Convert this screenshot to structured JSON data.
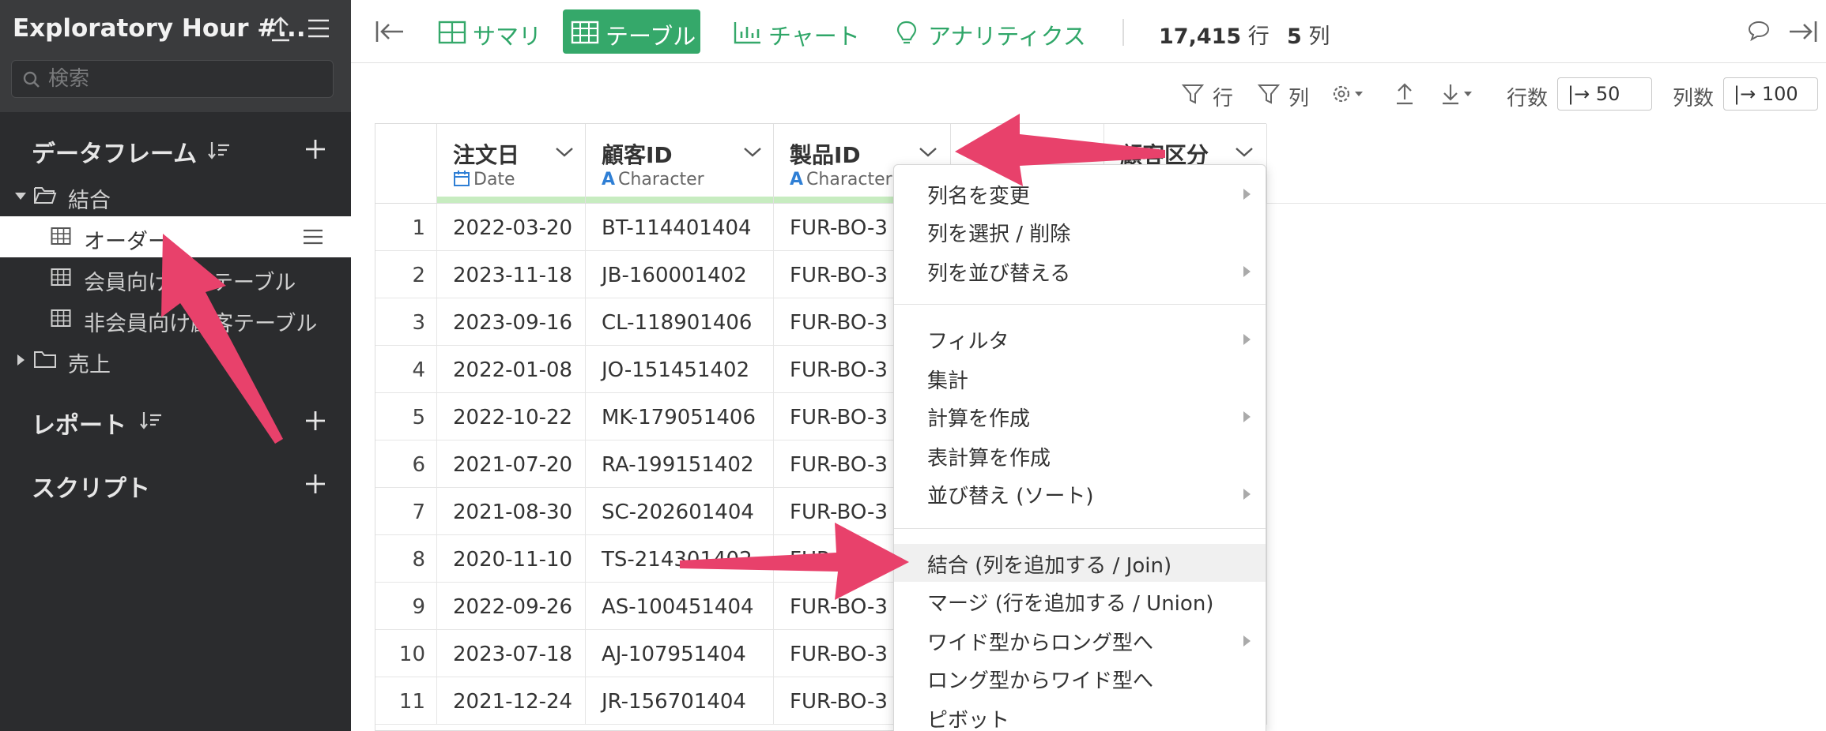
{
  "sidebar": {
    "project_title": "Exploratory Hour #...",
    "search_placeholder": "検索",
    "sections": {
      "dataframes": "データフレーム",
      "reports": "レポート",
      "scripts": "スクリプト"
    },
    "tree": {
      "folder_join": "結合",
      "item_order": "オーダー",
      "item_member": "会員向け顧客テーブル",
      "item_nonmember": "非会員向け顧客テーブル",
      "folder_sales": "売上"
    }
  },
  "topbar": {
    "tabs": {
      "summary": "サマリ",
      "table": "テーブル",
      "chart": "チャート",
      "analytics": "アナリティクス"
    },
    "active_tab": "テーブル",
    "row_count": "17,415",
    "row_unit": "行",
    "col_count": "5",
    "col_unit": "列"
  },
  "toolbar": {
    "filter_rows": "行",
    "filter_cols": "列",
    "rows_label": "行数",
    "rows_value": "|→ 50",
    "cols_label": "列数",
    "cols_value": "|→ 100"
  },
  "table": {
    "columns": [
      {
        "name": "注文日",
        "type": "Date"
      },
      {
        "name": "顧客ID",
        "type": "Character"
      },
      {
        "name": "製品ID",
        "type": "Character"
      },
      {
        "name": "",
        "type": ""
      },
      {
        "name": "顧客区分",
        "type": ""
      }
    ],
    "rows": [
      {
        "n": "1",
        "date": "2022-03-20",
        "cust": "BT-114401404",
        "prod": "FUR-BO-3"
      },
      {
        "n": "2",
        "date": "2023-11-18",
        "cust": "JB-160001402",
        "prod": "FUR-BO-3"
      },
      {
        "n": "3",
        "date": "2023-09-16",
        "cust": "CL-118901406",
        "prod": "FUR-BO-3"
      },
      {
        "n": "4",
        "date": "2022-01-08",
        "cust": "JO-151451402",
        "prod": "FUR-BO-3"
      },
      {
        "n": "5",
        "date": "2022-10-22",
        "cust": "MK-179051406",
        "prod": "FUR-BO-3"
      },
      {
        "n": "6",
        "date": "2021-07-20",
        "cust": "RA-199151402",
        "prod": "FUR-BO-3"
      },
      {
        "n": "7",
        "date": "2021-08-30",
        "cust": "SC-202601404",
        "prod": "FUR-BO-3"
      },
      {
        "n": "8",
        "date": "2020-11-10",
        "cust": "TS-214301402",
        "prod": "FUR-BO-3"
      },
      {
        "n": "9",
        "date": "2022-09-26",
        "cust": "AS-100451404",
        "prod": "FUR-BO-3"
      },
      {
        "n": "10",
        "date": "2023-07-18",
        "cust": "AJ-107951404",
        "prod": "FUR-BO-3"
      },
      {
        "n": "11",
        "date": "2021-12-24",
        "cust": "JR-156701404",
        "prod": "FUR-BO-3"
      }
    ]
  },
  "context_menu": {
    "rename": "列名を変更",
    "select_delete": "列を選択 / 削除",
    "reorder": "列を並び替える",
    "filter": "フィルタ",
    "aggregate": "集計",
    "create_calc": "計算を作成",
    "create_table_calc": "表計算を作成",
    "sort": "並び替え (ソート)",
    "join": "結合 (列を追加する / Join)",
    "merge": "マージ (行を追加する / Union)",
    "wide_to_long": "ワイド型からロング型へ",
    "long_to_wide": "ロング型からワイド型へ",
    "pivot": "ピボット"
  },
  "colors": {
    "sidebar_bg": "#2b2c2e",
    "accent_green": "#35a86a",
    "annotation_arrow": "#e8416b",
    "type_icon_blue": "#2f7fd5"
  }
}
